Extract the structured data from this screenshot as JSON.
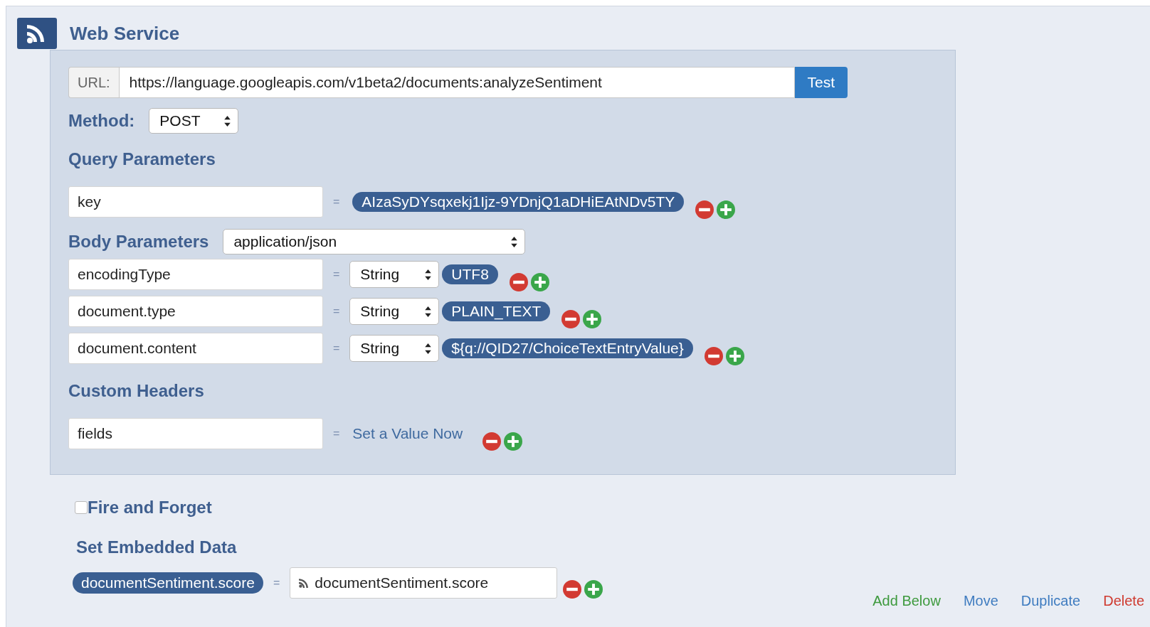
{
  "block": {
    "title": "Web Service"
  },
  "url": {
    "label": "URL:",
    "value": "https://language.googleapis.com/v1beta2/documents:analyzeSentiment",
    "button": "Test"
  },
  "method": {
    "label": "Method:",
    "value": "POST"
  },
  "query_parameters": {
    "title": "Query Parameters",
    "rows": [
      {
        "key": "key",
        "equals": "=",
        "value": "AIzaSyDYsqxekj1Ijz-9YDnjQ1aDHiEAtNDv5TY"
      }
    ]
  },
  "body_parameters": {
    "title": "Body Parameters",
    "content_type": "application/json",
    "rows": [
      {
        "key": "encodingType",
        "equals": "=",
        "type": "String",
        "value": "UTF8"
      },
      {
        "key": "document.type",
        "equals": "=",
        "type": "String",
        "value": "PLAIN_TEXT"
      },
      {
        "key": "document.content",
        "equals": "=",
        "type": "String",
        "value": "${q://QID27/ChoiceTextEntryValue}"
      }
    ]
  },
  "custom_headers": {
    "title": "Custom Headers",
    "rows": [
      {
        "key": "fields",
        "equals": "=",
        "value": "Set a Value Now"
      }
    ]
  },
  "fire_and_forget": {
    "label": "Fire and Forget",
    "checked": false
  },
  "embedded_data": {
    "title": "Set Embedded Data",
    "rows": [
      {
        "name": "documentSentiment.score",
        "equals": "=",
        "value": "documentSentiment.score"
      }
    ]
  },
  "actions": [
    {
      "label": "Add Below",
      "kind": "add"
    },
    {
      "label": "Move",
      "kind": "neutral"
    },
    {
      "label": "Duplicate",
      "kind": "neutral"
    },
    {
      "label": "Delete",
      "kind": "danger"
    }
  ]
}
